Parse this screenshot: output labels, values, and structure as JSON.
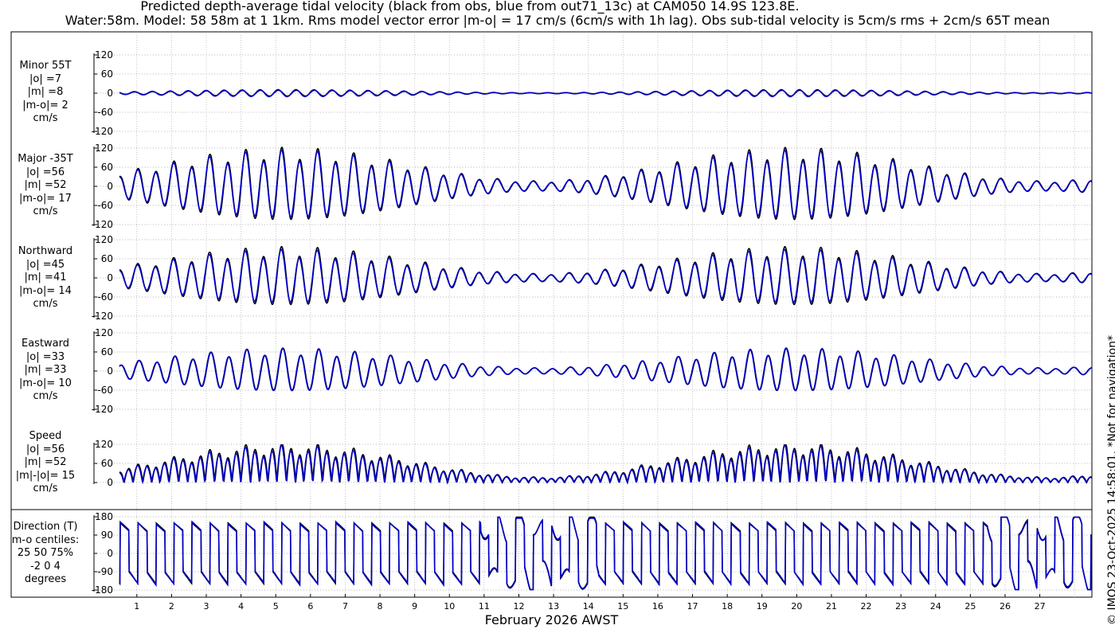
{
  "title_line1": "Predicted depth-average tidal velocity (black from obs, blue from out71_13c) at CAM050 14.9S 123.8E.",
  "title_line2": "Water:58m. Model: 58 58m at 1 1km. Rms model vector error |m-o| = 17 cm/s (6cm/s with 1h lag). Obs sub-tidal velocity is 5cm/s rms + 2cm/s 65T mean",
  "credit": "© IMOS 23-Oct-2025 14:58:01. *Not for navigation*",
  "chart_data": {
    "type": "line",
    "xlabel": "February 2026 AWST",
    "xticks": [
      "1",
      "2",
      "3",
      "4",
      "5",
      "6",
      "7",
      "8",
      "9",
      "10",
      "11",
      "12",
      "13",
      "14",
      "15",
      "16",
      "17",
      "18",
      "19",
      "20",
      "21",
      "22",
      "23",
      "24",
      "25",
      "26",
      "27"
    ],
    "xlim_days": [
      0.5,
      28.5
    ],
    "series_colors": {
      "obs": "#000000",
      "model": "#0000cc"
    },
    "panels": [
      {
        "id": "minor",
        "label": [
          "Minor 55T",
          "|o| =7",
          "|m| =8",
          "|m-o|= 2",
          "cm/s"
        ],
        "yticks": [
          "120",
          "60",
          "0",
          "-60",
          "-120"
        ],
        "ylim": [
          -120,
          120
        ],
        "amplitude_obs": 7,
        "amplitude_model": 8
      },
      {
        "id": "major",
        "label": [
          "Major -35T",
          "|o| =56",
          "|m| =52",
          "|m-o|= 17",
          "cm/s"
        ],
        "yticks": [
          "120",
          "60",
          "0",
          "-60",
          "-120"
        ],
        "ylim": [
          -120,
          120
        ],
        "amplitude_obs": 56,
        "amplitude_model": 52
      },
      {
        "id": "north",
        "label": [
          "Northward",
          "|o| =45",
          "|m| =41",
          "|m-o|= 14",
          "cm/s"
        ],
        "yticks": [
          "120",
          "60",
          "0",
          "-60",
          "-120"
        ],
        "ylim": [
          -120,
          120
        ],
        "amplitude_obs": 45,
        "amplitude_model": 41
      },
      {
        "id": "east",
        "label": [
          "Eastward",
          "|o| =33",
          "|m| =33",
          "|m-o|= 10",
          "cm/s"
        ],
        "yticks": [
          "120",
          "60",
          "0",
          "-60",
          "-120"
        ],
        "ylim": [
          -120,
          120
        ],
        "amplitude_obs": 33,
        "amplitude_model": 33
      },
      {
        "id": "speed",
        "label": [
          "Speed",
          "|o| =56",
          "|m| =52",
          "|m|-|o|= 15",
          "cm/s"
        ],
        "yticks": [
          "120",
          "60",
          "0"
        ],
        "ylim": [
          0,
          120
        ],
        "amplitude_obs": 56,
        "amplitude_model": 52
      },
      {
        "id": "direction",
        "label": [
          "Direction (T)",
          "m-o centiles:",
          "25  50  75%",
          "-2  0  4",
          "degrees"
        ],
        "yticks": [
          "180",
          "90",
          "0",
          "-90",
          "-180"
        ],
        "ylim": [
          -180,
          180
        ]
      }
    ]
  }
}
